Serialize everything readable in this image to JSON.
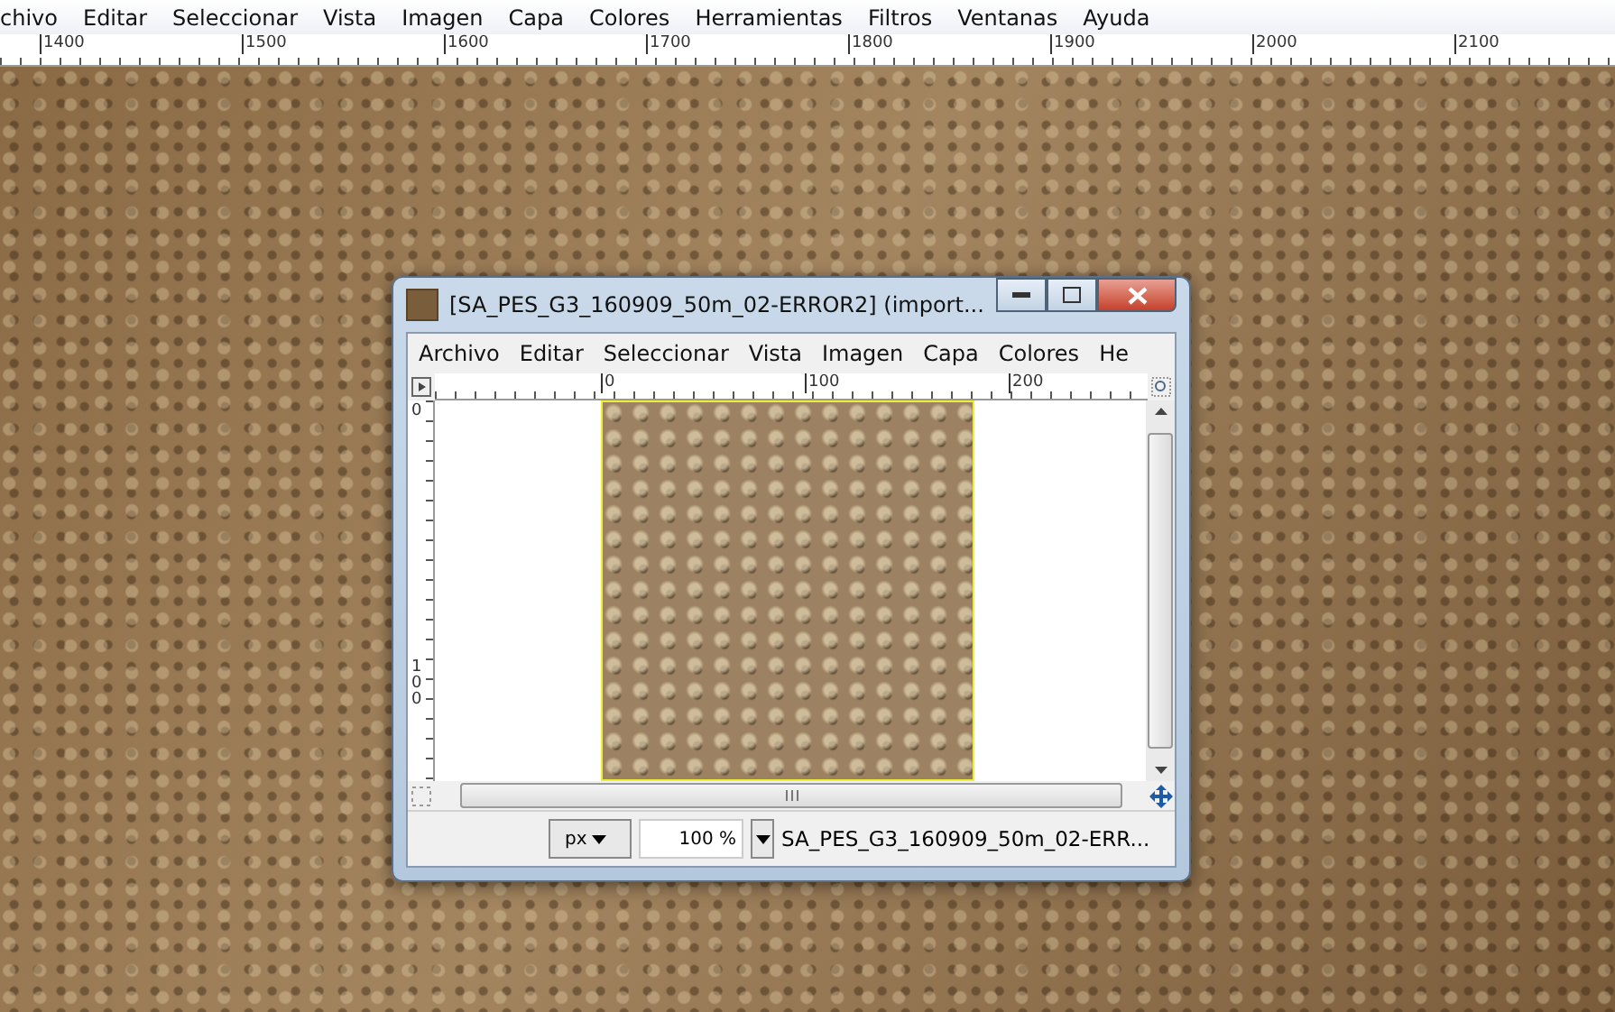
{
  "main_menu": [
    "chivo",
    "Editar",
    "Seleccionar",
    "Vista",
    "Imagen",
    "Capa",
    "Colores",
    "Herramientas",
    "Filtros",
    "Ventanas",
    "Ayuda"
  ],
  "main_ruler": [
    "1400",
    "1500",
    "1600",
    "1700",
    "1800",
    "1900",
    "2000",
    "2100"
  ],
  "image_window": {
    "title": "[SA_PES_G3_160909_50m_02-ERROR2] (import...",
    "menu": [
      "Archivo",
      "Editar",
      "Seleccionar",
      "Vista",
      "Imagen",
      "Capa",
      "Colores",
      "He"
    ],
    "top_ruler": [
      "0",
      "100",
      "200"
    ],
    "left_ruler": [
      "0",
      "100"
    ],
    "status": {
      "unit": "px",
      "zoom": "100 %",
      "filename": "SA_PES_G3_160909_50m_02-ERR..."
    }
  }
}
